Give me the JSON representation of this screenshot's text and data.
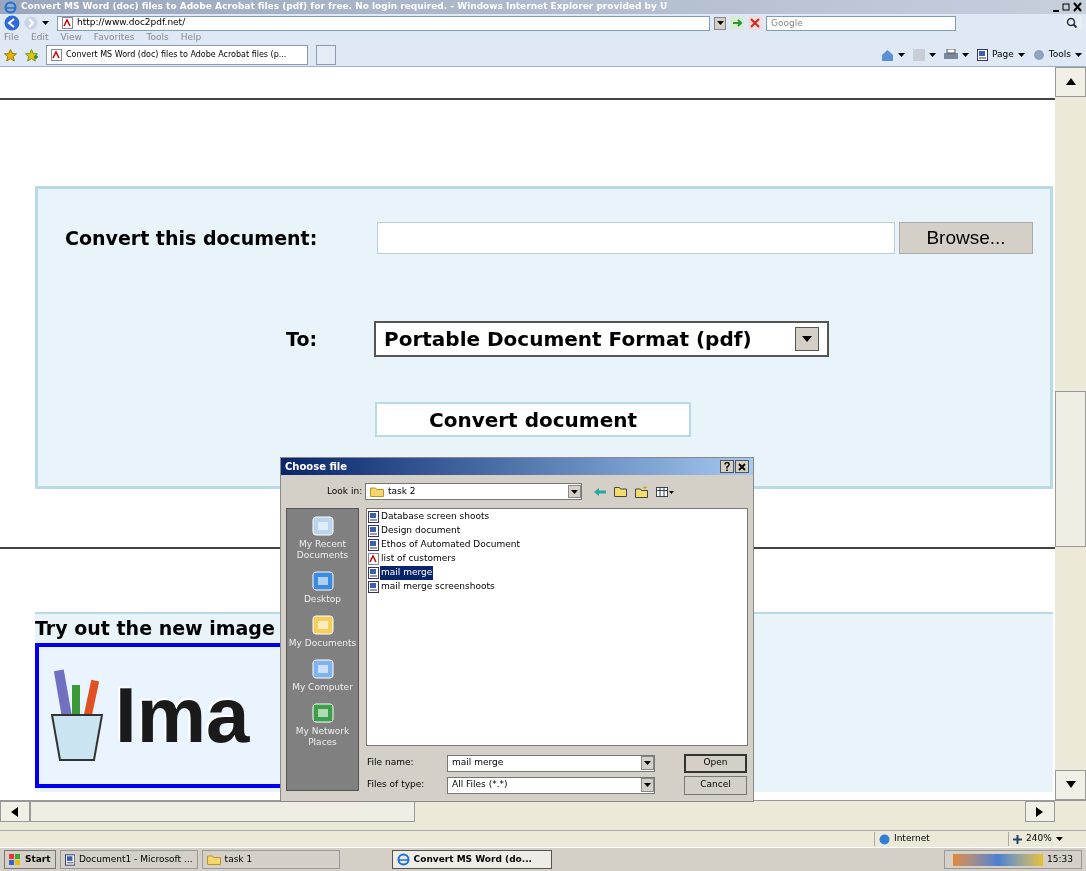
{
  "window": {
    "title": "Convert MS Word (doc) files to Adobe Acrobat files (pdf) for free. No login required. - Windows Internet Explorer provided by U"
  },
  "address_bar": {
    "url": "http://www.doc2pdf.net/",
    "search_placeholder": "Google"
  },
  "menu": [
    "File",
    "Edit",
    "View",
    "Favorites",
    "Tools",
    "Help"
  ],
  "tab": {
    "label": "Convert MS Word (doc) files to Adobe Acrobat files (p...",
    "selected": true
  },
  "command_bar": [
    {
      "kind": "home"
    },
    {
      "kind": "feeds"
    },
    {
      "kind": "print"
    },
    {
      "kind": "page",
      "label": "Page"
    },
    {
      "kind": "tools",
      "label": "Tools"
    }
  ],
  "page": {
    "convert_label": "Convert this document:",
    "browse_button": "Browse...",
    "to_label": "To:",
    "format": "Portable Document Format (pdf)",
    "convert_button": "Convert document",
    "promo_title": "Try out the new image",
    "banner_text": "Ima"
  },
  "dialog": {
    "title": "Choose file",
    "look_in_label": "Look in:",
    "look_in": "task 2",
    "places": [
      "My Recent Documents",
      "Desktop",
      "My Documents",
      "My Computer",
      "My Network Places"
    ],
    "files": [
      {
        "name": "Database screen shoots",
        "kind": "word",
        "selected": false
      },
      {
        "name": "Design document",
        "kind": "word",
        "selected": false
      },
      {
        "name": "Ethos of Automated Document",
        "kind": "word",
        "selected": false
      },
      {
        "name": "list of customers",
        "kind": "pdf",
        "selected": false
      },
      {
        "name": "mail merge",
        "kind": "word",
        "selected": true
      },
      {
        "name": "mail merge screenshoots",
        "kind": "word",
        "selected": false
      }
    ],
    "file_name_label": "File name:",
    "file_name": "mail merge",
    "type_label": "Files of type:",
    "type": "All Files (*.*)",
    "open_button": "Open",
    "cancel_button": "Cancel"
  },
  "status_bar": {
    "zone": "Internet",
    "zoom": "240%"
  },
  "taskbar": {
    "start": "Start",
    "items": [
      {
        "label": "Document1 - Microsoft ...",
        "kind": "word",
        "selected": false
      },
      {
        "label": "task 1",
        "kind": "folder",
        "selected": false
      },
      {
        "label": "Convert MS Word (do...",
        "kind": "ie",
        "selected": true
      }
    ],
    "clock": "15:33"
  }
}
